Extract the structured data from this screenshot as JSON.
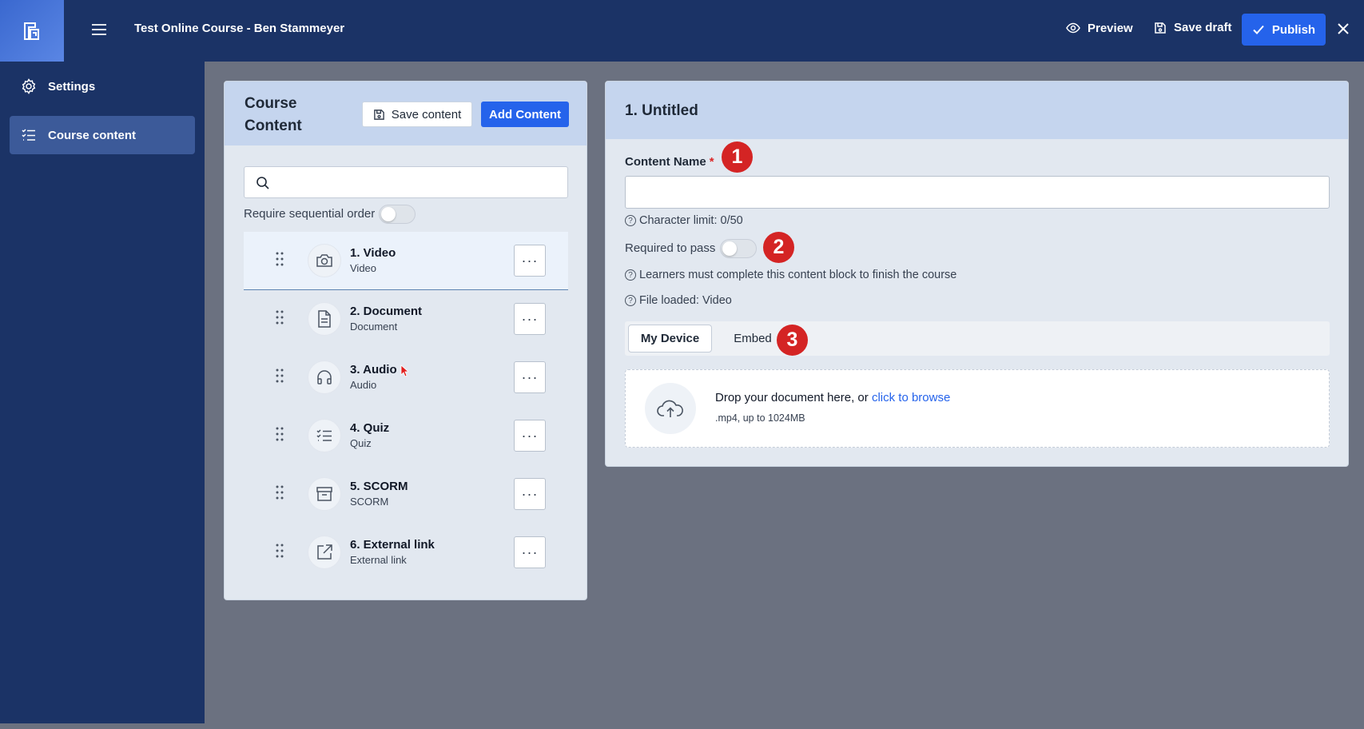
{
  "topbar": {
    "course_title": "Test Online Course - Ben Stammeyer",
    "preview_label": "Preview",
    "save_draft_label": "Save draft",
    "publish_label": "Publish"
  },
  "sidebar": {
    "items": [
      {
        "label": "Settings",
        "icon": "gear-icon"
      },
      {
        "label": "Course content",
        "icon": "checklist-icon"
      }
    ]
  },
  "course_content": {
    "title": "Course Content",
    "save_content_label": "Save content",
    "add_content_label": "Add Content",
    "search_placeholder": "",
    "sequential_label": "Require sequential order",
    "sequential_enabled": false,
    "items": [
      {
        "name": "1. Video",
        "type": "Video",
        "icon": "camera-icon",
        "selected": true
      },
      {
        "name": "2. Document",
        "type": "Document",
        "icon": "document-icon",
        "selected": false
      },
      {
        "name": "3. Audio",
        "type": "Audio",
        "icon": "headphones-icon",
        "selected": false
      },
      {
        "name": "4. Quiz",
        "type": "Quiz",
        "icon": "checklist-icon",
        "selected": false
      },
      {
        "name": "5. SCORM",
        "type": "SCORM",
        "icon": "archive-icon",
        "selected": false
      },
      {
        "name": "6. External link",
        "type": "External link",
        "icon": "external-link-icon",
        "selected": false
      }
    ],
    "more_label": "···"
  },
  "editor": {
    "title": "1. Untitled",
    "content_name_label": "Content Name",
    "required_marker": "*",
    "content_name_value": "",
    "char_limit": "Character limit: 0/50",
    "required_to_pass_label": "Required to pass",
    "required_to_pass_enabled": false,
    "required_hint": "Learners must complete this content block to finish the course",
    "file_loaded": "File loaded: Video",
    "tabs": [
      "My Device",
      "Embed"
    ],
    "active_tab": "My Device",
    "drop_text": "Drop your document here, or",
    "drop_link": "click to browse",
    "drop_sub": ".mp4, up to 1024MB"
  },
  "annotations": [
    "1",
    "2",
    "3"
  ],
  "colors": {
    "nav_bg": "#1b3366",
    "accent": "#2563eb",
    "panel_header": "#c5d5ee",
    "badge": "#d42424"
  }
}
